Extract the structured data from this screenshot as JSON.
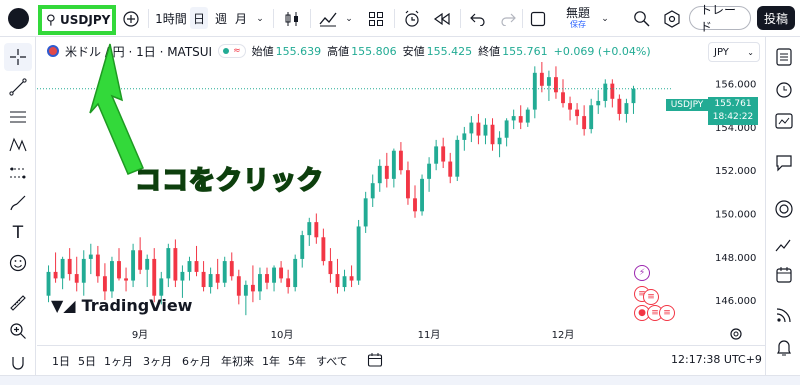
{
  "toolbar": {
    "symbol": "USDJPY",
    "interval": "1時間",
    "day": "日",
    "week": "週",
    "month": "月",
    "layout_name": "無題",
    "save_label": "保存",
    "trade_label": "トレード",
    "post_label": "投稿"
  },
  "legend": {
    "title": "米ドル / 円 · 1日 · MATSUI",
    "open_label": "始値",
    "open": "155.639",
    "high_label": "高値",
    "high": "155.806",
    "low_label": "安値",
    "low": "155.425",
    "close_label": "終値",
    "close": "155.761",
    "change": "+0.069 (+0.04%)"
  },
  "currency": "JPY",
  "price_tag_symbol": "USDJPY",
  "price_tag_value": "155.761",
  "price_tag_time": "18:42:22",
  "callout": "ココをクリック",
  "tv_logo_text": "TradingView",
  "bottom": {
    "ranges": [
      "1日",
      "5日",
      "1ヶ月",
      "3ヶ月",
      "6ヶ月",
      "年初来",
      "1年",
      "5年",
      "すべて"
    ],
    "clock": "12:17:38 UTC+9"
  },
  "chart_data": {
    "type": "candlestick",
    "y_ticks": [
      "156.000",
      "154.000",
      "152.000",
      "150.000",
      "148.000",
      "146.000"
    ],
    "x_ticks": [
      "9月",
      "10月",
      "11月",
      "12月"
    ],
    "ylim": [
      144.8,
      157.0
    ],
    "candles": [
      [
        146.2,
        147.6,
        145.9,
        147.3
      ],
      [
        147.3,
        148.2,
        146.8,
        147.0
      ],
      [
        147.0,
        148.0,
        146.5,
        147.9
      ],
      [
        147.9,
        148.4,
        146.9,
        147.2
      ],
      [
        147.2,
        148.0,
        146.4,
        146.8
      ],
      [
        146.8,
        148.3,
        146.2,
        147.9
      ],
      [
        147.9,
        148.6,
        147.2,
        148.1
      ],
      [
        148.1,
        148.5,
        146.8,
        147.1
      ],
      [
        147.1,
        147.7,
        146.0,
        146.4
      ],
      [
        146.4,
        148.0,
        146.1,
        147.8
      ],
      [
        147.8,
        148.4,
        146.9,
        147.0
      ],
      [
        147.0,
        147.5,
        146.4,
        146.9
      ],
      [
        146.9,
        148.6,
        146.6,
        148.3
      ],
      [
        148.3,
        148.9,
        147.2,
        147.4
      ],
      [
        147.4,
        148.1,
        146.6,
        147.9
      ],
      [
        147.9,
        148.4,
        145.9,
        146.2
      ],
      [
        146.2,
        147.3,
        145.8,
        147.0
      ],
      [
        147.0,
        148.6,
        146.6,
        148.4
      ],
      [
        148.4,
        148.8,
        146.6,
        146.9
      ],
      [
        146.9,
        147.6,
        146.1,
        147.3
      ],
      [
        147.3,
        148.0,
        146.9,
        147.8
      ],
      [
        147.8,
        148.5,
        147.1,
        147.3
      ],
      [
        147.3,
        147.8,
        146.4,
        146.6
      ],
      [
        146.6,
        147.5,
        146.3,
        147.2
      ],
      [
        147.2,
        147.9,
        146.5,
        146.8
      ],
      [
        146.8,
        148.0,
        146.6,
        147.8
      ],
      [
        147.8,
        148.2,
        146.9,
        147.1
      ],
      [
        147.1,
        147.4,
        145.8,
        146.2
      ],
      [
        146.2,
        146.9,
        145.3,
        146.7
      ],
      [
        146.7,
        147.6,
        145.9,
        146.4
      ],
      [
        146.4,
        147.5,
        146.0,
        147.2
      ],
      [
        147.2,
        147.5,
        146.5,
        146.8
      ],
      [
        146.8,
        147.6,
        146.4,
        147.5
      ],
      [
        147.5,
        147.8,
        146.8,
        147.0
      ],
      [
        147.0,
        147.4,
        146.3,
        146.6
      ],
      [
        146.6,
        148.1,
        146.4,
        147.9
      ],
      [
        147.9,
        149.2,
        147.5,
        149.0
      ],
      [
        149.0,
        149.8,
        148.5,
        149.6
      ],
      [
        149.6,
        150.0,
        148.6,
        148.9
      ],
      [
        148.9,
        149.3,
        147.6,
        147.8
      ],
      [
        147.8,
        148.4,
        146.8,
        147.2
      ],
      [
        147.2,
        147.9,
        146.3,
        146.6
      ],
      [
        146.6,
        147.4,
        146.4,
        147.1
      ],
      [
        147.1,
        147.6,
        146.6,
        146.9
      ],
      [
        146.9,
        149.7,
        146.7,
        149.4
      ],
      [
        149.4,
        151.0,
        149.1,
        150.7
      ],
      [
        150.7,
        151.8,
        150.3,
        151.4
      ],
      [
        151.4,
        152.5,
        151.0,
        152.2
      ],
      [
        152.2,
        152.8,
        151.2,
        151.6
      ],
      [
        151.6,
        153.0,
        151.2,
        152.9
      ],
      [
        152.9,
        153.3,
        151.8,
        152.0
      ],
      [
        152.0,
        152.4,
        150.4,
        150.7
      ],
      [
        150.7,
        151.3,
        149.8,
        150.1
      ],
      [
        150.1,
        151.8,
        149.9,
        151.6
      ],
      [
        151.6,
        152.6,
        151.0,
        152.3
      ],
      [
        152.3,
        153.4,
        152.0,
        153.1
      ],
      [
        153.1,
        153.5,
        152.1,
        152.4
      ],
      [
        152.4,
        152.8,
        151.4,
        151.7
      ],
      [
        151.7,
        153.6,
        151.5,
        153.4
      ],
      [
        153.4,
        154.0,
        152.9,
        153.7
      ],
      [
        153.7,
        154.5,
        153.3,
        154.2
      ],
      [
        154.2,
        154.6,
        153.2,
        153.6
      ],
      [
        153.6,
        154.4,
        153.2,
        154.1
      ],
      [
        154.1,
        154.4,
        152.9,
        153.2
      ],
      [
        153.2,
        153.8,
        152.6,
        153.5
      ],
      [
        153.5,
        154.4,
        153.1,
        154.3
      ],
      [
        154.3,
        154.8,
        153.9,
        154.5
      ],
      [
        154.5,
        155.0,
        153.9,
        154.2
      ],
      [
        154.2,
        154.9,
        154.0,
        154.8
      ],
      [
        154.8,
        156.8,
        154.4,
        156.5
      ],
      [
        156.5,
        157.0,
        155.6,
        155.9
      ],
      [
        155.9,
        156.6,
        155.2,
        156.3
      ],
      [
        156.3,
        156.8,
        155.3,
        155.6
      ],
      [
        155.6,
        156.2,
        154.9,
        155.1
      ],
      [
        155.1,
        155.4,
        154.3,
        154.8
      ],
      [
        154.8,
        155.1,
        154.1,
        154.5
      ],
      [
        154.5,
        155.0,
        153.6,
        153.9
      ],
      [
        153.9,
        155.3,
        153.7,
        155.0
      ],
      [
        155.0,
        155.7,
        154.6,
        155.2
      ],
      [
        155.2,
        156.2,
        154.9,
        156.0
      ],
      [
        156.0,
        156.2,
        154.9,
        155.3
      ],
      [
        155.3,
        155.5,
        154.3,
        154.6
      ],
      [
        154.6,
        155.3,
        154.2,
        155.1
      ],
      [
        155.1,
        155.9,
        154.6,
        155.761
      ]
    ]
  }
}
